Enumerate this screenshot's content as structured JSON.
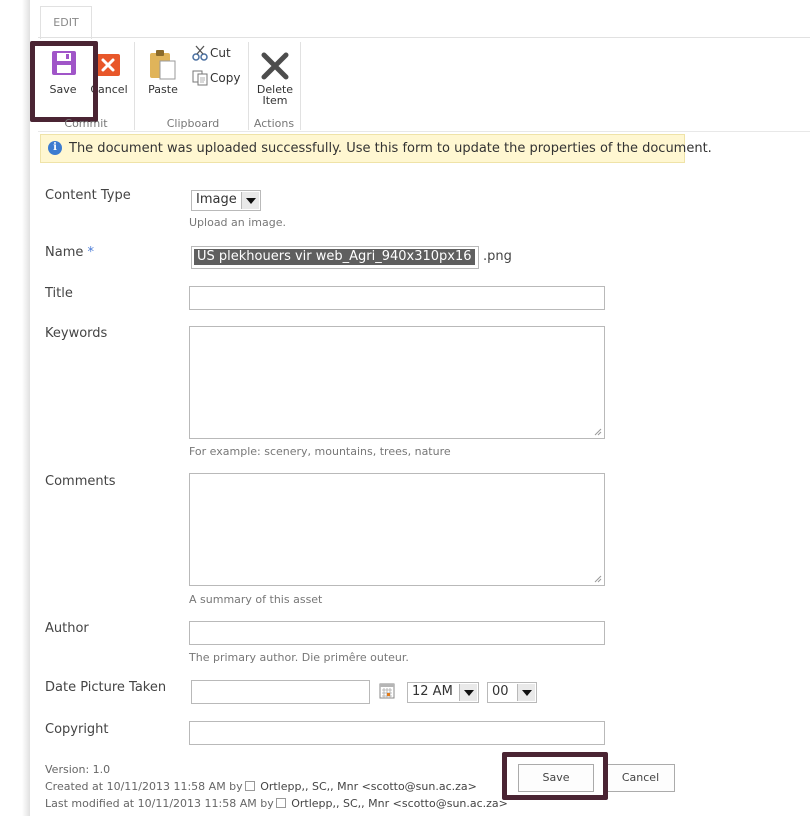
{
  "ribbon": {
    "tab_label": "EDIT",
    "save_label": "Save",
    "cancel_label": "Cancel",
    "paste_label": "Paste",
    "cut_label": "Cut",
    "copy_label": "Copy",
    "delete_line1": "Delete",
    "delete_line2": "Item",
    "groups": {
      "commit": "Commit",
      "clipboard": "Clipboard",
      "actions": "Actions"
    },
    "icons": {
      "save": "floppy-disk-icon",
      "cancel": "x-icon",
      "paste": "clipboard-icon",
      "cut": "scissors-icon",
      "copy": "copy-icon",
      "delete": "x-icon"
    },
    "colors": {
      "save_icon": "#a055c8",
      "cancel_icon": "#e8572a",
      "highlight_border": "#4a2433"
    }
  },
  "status": {
    "message": "The document was uploaded successfully. Use this form to update the properties of the document.",
    "icon": "info-icon",
    "background": "#fff7d1"
  },
  "form": {
    "content_type": {
      "label": "Content Type",
      "value": "Image",
      "hint": "Upload an image."
    },
    "name": {
      "label": "Name",
      "required_marker": "*",
      "value": "US plekhouers vir web_Agri_940x310px16",
      "extension": ".png"
    },
    "title": {
      "label": "Title",
      "value": ""
    },
    "keywords": {
      "label": "Keywords",
      "value": "",
      "hint": "For example: scenery, mountains, trees, nature"
    },
    "comments": {
      "label": "Comments",
      "value": "",
      "hint": "A summary of this asset"
    },
    "author": {
      "label": "Author",
      "value": "",
      "hint": "The primary author. Die primêre outeur."
    },
    "date_taken": {
      "label": "Date Picture Taken",
      "value": "",
      "hour": "12 AM",
      "minute": "00",
      "calendar_icon": "calendar-icon"
    },
    "copyright": {
      "label": "Copyright",
      "value": ""
    }
  },
  "footer": {
    "version": "Version: 1.0",
    "created_prefix": "Created at 10/11/2013 11:58 AM  by",
    "created_by": "Ortlepp,, SC,, Mnr <scotto@sun.ac.za>",
    "modified_prefix": "Last modified at 10/11/2013 11:58 AM  by",
    "modified_by": "Ortlepp,, SC,, Mnr <scotto@sun.ac.za>",
    "save_label": "Save",
    "cancel_label": "Cancel"
  }
}
